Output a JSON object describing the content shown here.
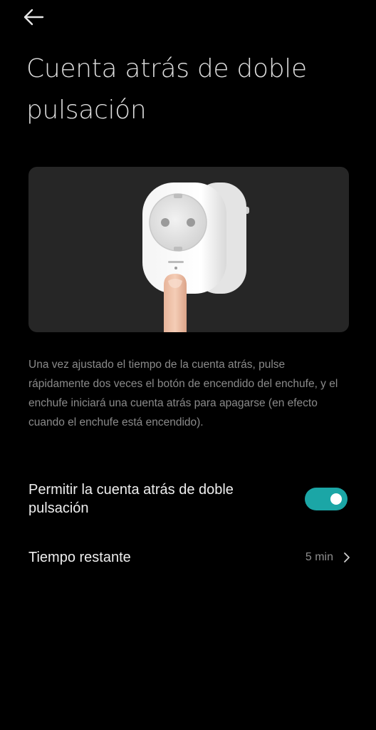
{
  "header": {
    "back_icon": "arrow-left-icon",
    "title": "Cuenta atrás de doble pulsación"
  },
  "hero": {
    "image": "smart-plug-press-illustration"
  },
  "description": "Una vez ajustado el tiempo de la cuenta atrás, pulse rápidamente dos veces el botón de encendido del enchufe, y el enchufe iniciará una cuenta atrás para apagarse (en efecto cuando el enchufe está encendido).",
  "settings": {
    "allow_double_press": {
      "label": "Permitir la cuenta atrás de doble pulsación",
      "enabled": true
    },
    "remaining_time": {
      "label": "Tiempo restante",
      "value": "5 min",
      "chevron_icon": "chevron-right-icon"
    }
  },
  "colors": {
    "background": "#000000",
    "card": "#262626",
    "accent": "#1ba6a6",
    "text_primary": "#eeeeee",
    "text_secondary": "#8a8a8a"
  }
}
